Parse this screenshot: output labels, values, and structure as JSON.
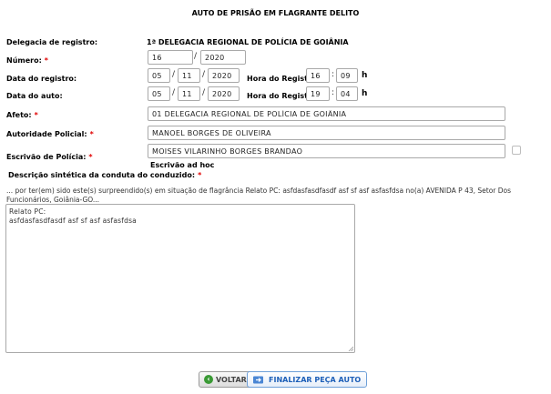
{
  "page_title": "AUTO DE PRISÃO EM FLAGRANTE DELITO",
  "delegacia": {
    "label": "Delegacia de registro:",
    "value": "1ª DELEGACIA REGIONAL DE POLÍCIA DE GOIÂNIA"
  },
  "numero": {
    "label": "Número:",
    "required_mark": "*",
    "value": "16",
    "year": "2020",
    "separator": "/"
  },
  "data_registro": {
    "label": "Data do registro:",
    "day": "05",
    "month": "11",
    "year": "2020",
    "hora_label": "Hora do Registro:",
    "hour": "16",
    "minute": "09",
    "hour_suffix": "h"
  },
  "data_auto": {
    "label": "Data do auto:",
    "day": "05",
    "month": "11",
    "year": "2020",
    "hora_label": "Hora do Registro:",
    "hour": "19",
    "minute": "04",
    "hour_suffix": "h"
  },
  "time_separator": ":",
  "afeto": {
    "label": "Afeto:",
    "required_mark": "*",
    "value": "01 DELEGACIA REGIONAL DE POLÍCIA DE GOIÂNIA"
  },
  "autoridade": {
    "label": "Autoridade Policial:",
    "required_mark": "*",
    "value": "MANOEL BORGES DE OLIVEIRA"
  },
  "escrivao": {
    "label": "Escrivão de Polícia:",
    "required_mark": "*",
    "value": "MOISES VILARINHO BORGES BRANDAO",
    "ad_hoc_label": "Escrivão ad hoc"
  },
  "conduta": {
    "label": "Descrição sintética da conduta do conduzido:",
    "required_mark": "*",
    "narrative": "... por ter(em) sido este(s) surpreendido(s) em situação de flagrância Relato PC: asfdasfasdfasdf asf sf asf asfasfdsa no(a) AVENIDA P 43, Setor Dos Funcionários, Goiânia-GO...",
    "text": "Relato PC:\nasfdasfasdfasdf asf sf asf asfasfdsa"
  },
  "buttons": {
    "voltar": "VOLTAR",
    "finalizar": "FINALIZAR PEÇA AUTO"
  },
  "colors": {
    "required": "#e00000",
    "primary_button_text": "#1d5fb8",
    "back_icon": "#3a9a35"
  },
  "icons": {
    "back": "back-arrow-circle-icon",
    "finalizar": "send-arrow-icon",
    "resize": "resize-grip-icon"
  }
}
